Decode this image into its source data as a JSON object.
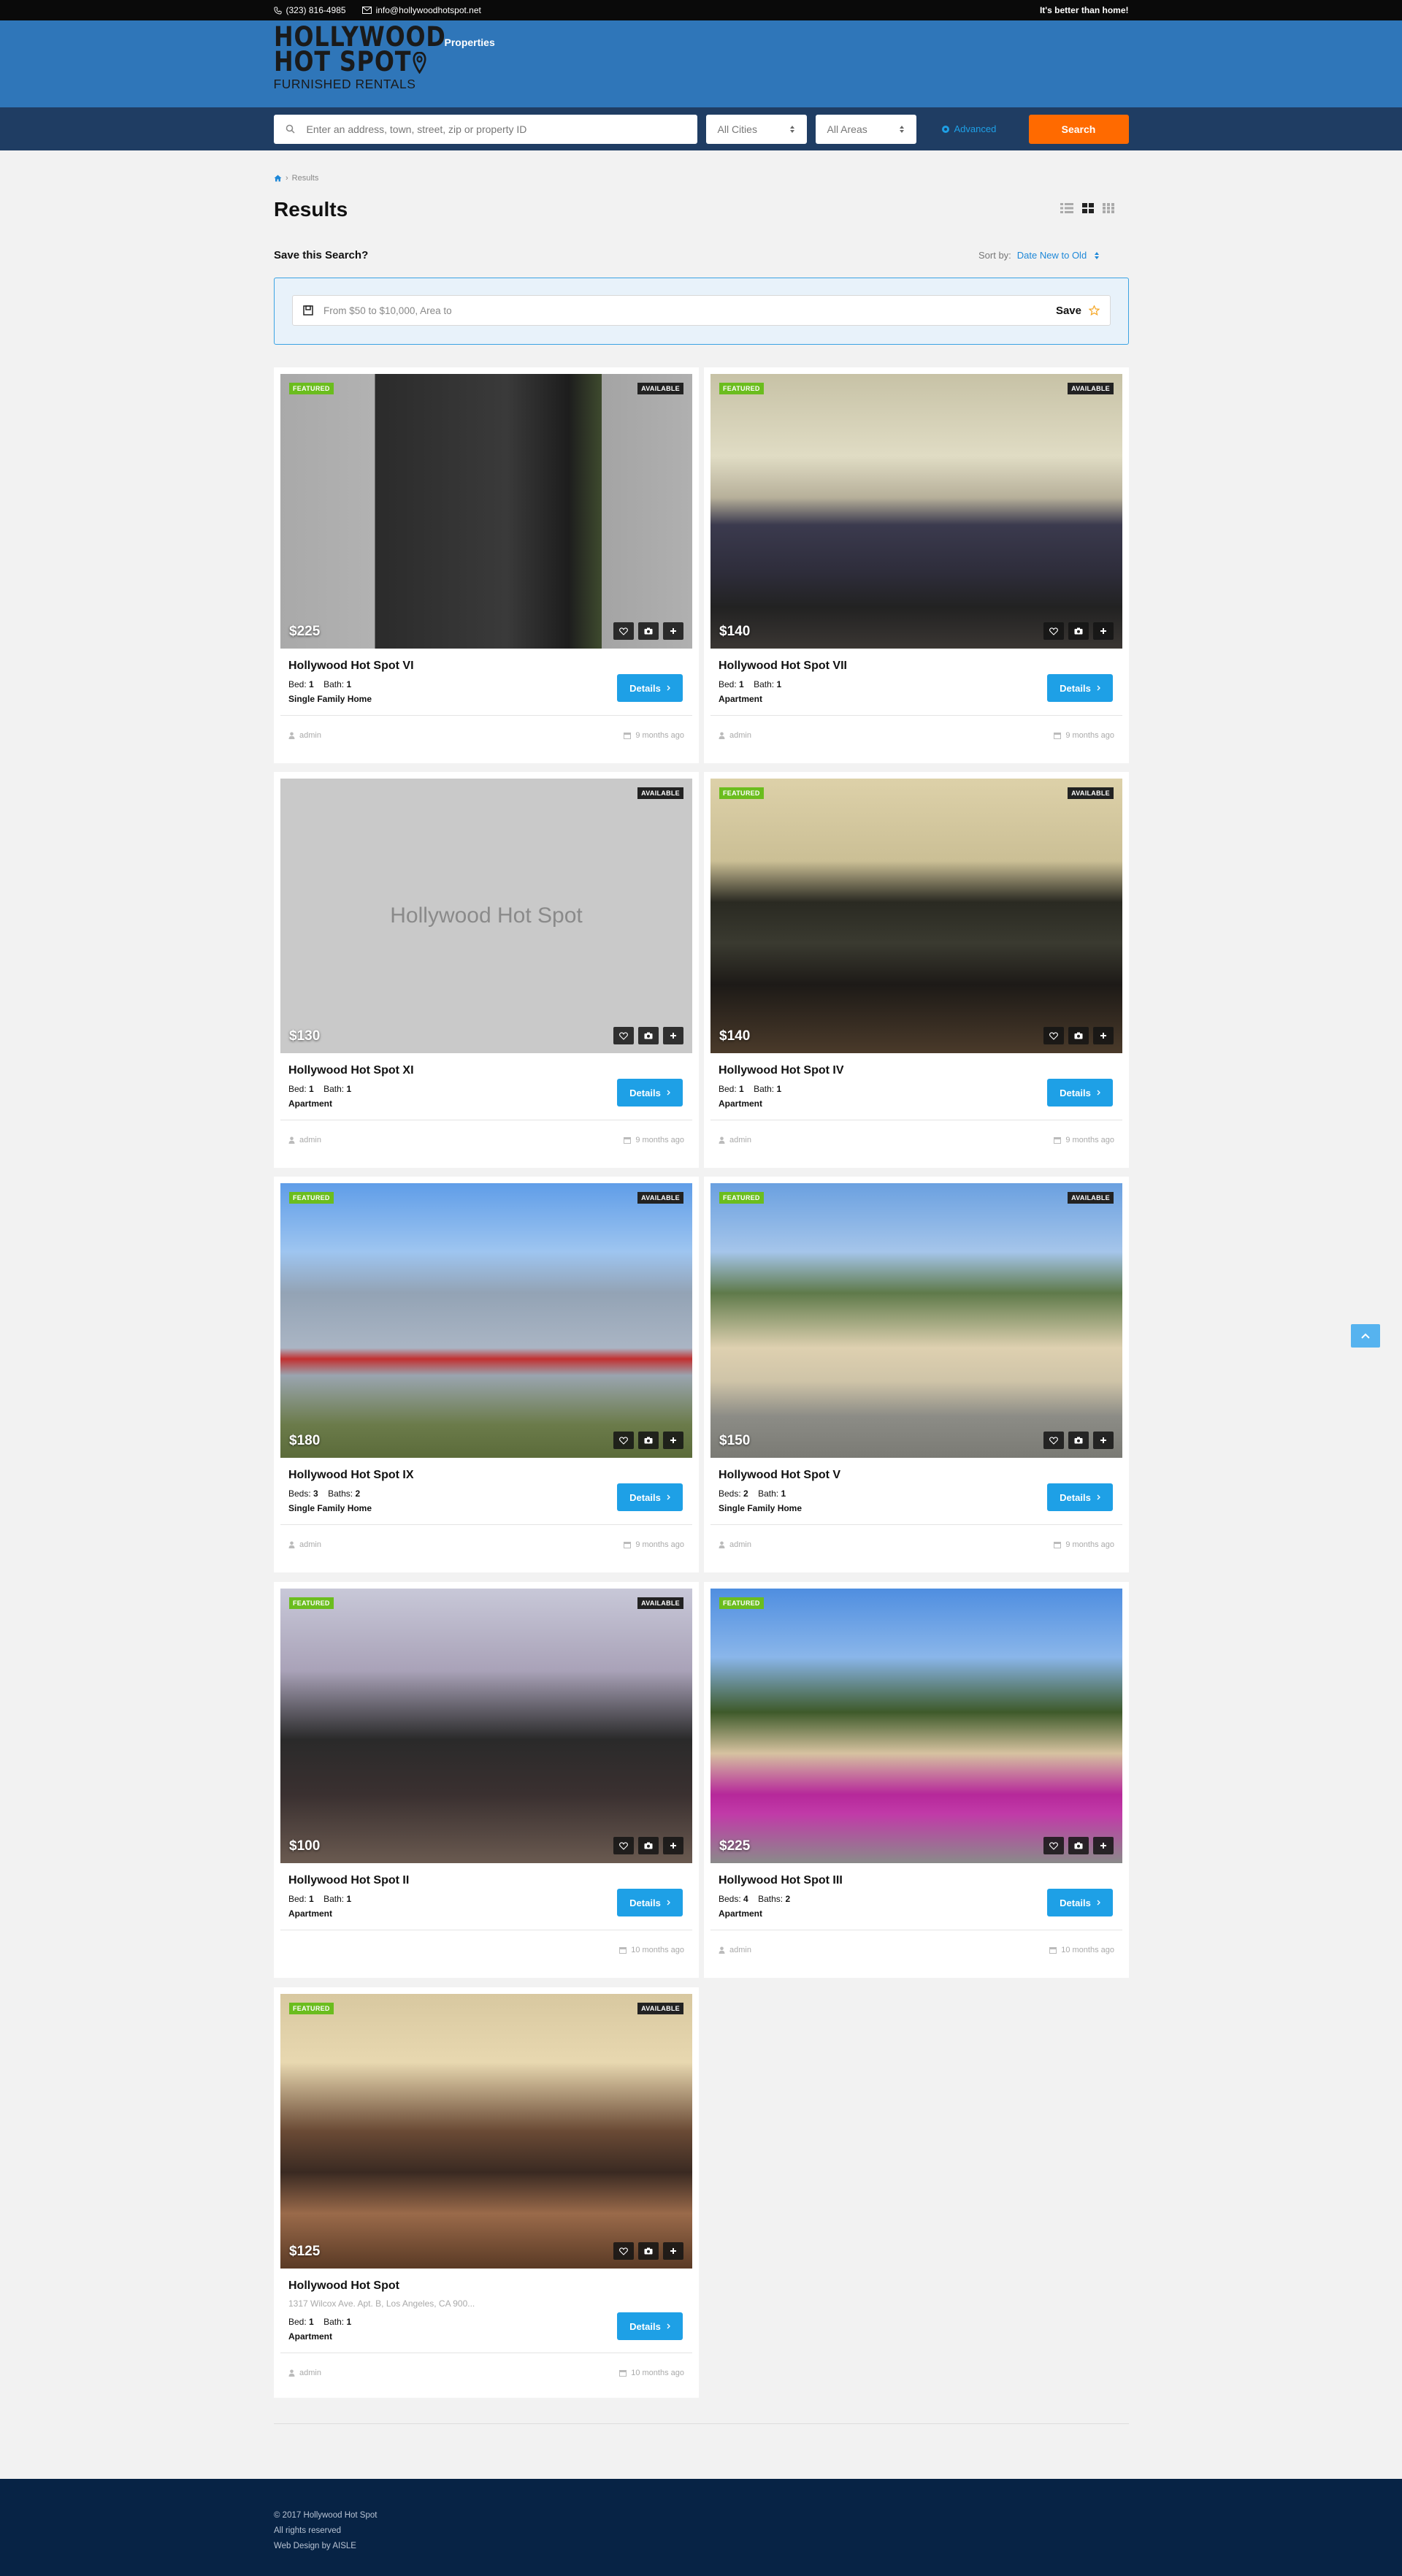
{
  "topbar": {
    "phone": "(323) 816-4985",
    "email": "info@hollywoodhotspot.net",
    "tagline": "It's better than home!"
  },
  "header": {
    "logo_line1": "HOLLYWOOD",
    "logo_line2": "HOT SPOT",
    "logo_line3": "FURNISHED RENTALS",
    "nav_properties": "Properties"
  },
  "search": {
    "placeholder": "Enter an address, town, street, zip or property ID",
    "cities": "All Cities",
    "areas": "All Areas",
    "advanced": "Advanced",
    "button": "Search"
  },
  "breadcrumb": {
    "current": "Results"
  },
  "page_title": "Results",
  "save_search": {
    "title": "Save this Search?",
    "criteria": "From $50 to $10,000, Area  to",
    "save_label": "Save"
  },
  "sort": {
    "label": "Sort by:",
    "value": "Date New to Old"
  },
  "labels": {
    "featured": "FEATURED",
    "available": "AVAILABLE",
    "details": "Details"
  },
  "listings": [
    {
      "title": "Hollywood Hot Spot VI",
      "price": "$225",
      "featured": true,
      "bed_label": "Bed:",
      "bed": "1",
      "bath_label": "Bath:",
      "bath": "1",
      "type": "Single Family Home",
      "author": "admin",
      "date": "9 months ago"
    },
    {
      "title": "Hollywood Hot Spot VII",
      "price": "$140",
      "featured": true,
      "bed_label": "Bed:",
      "bed": "1",
      "bath_label": "Bath:",
      "bath": "1",
      "type": "Apartment",
      "author": "admin",
      "date": "9 months ago"
    },
    {
      "title": "Hollywood Hot Spot XI",
      "price": "$130",
      "featured": false,
      "placeholder": "Hollywood Hot Spot",
      "bed_label": "Bed:",
      "bed": "1",
      "bath_label": "Bath:",
      "bath": "1",
      "type": "Apartment",
      "author": "admin",
      "date": "9 months ago"
    },
    {
      "title": "Hollywood Hot Spot IV",
      "price": "$140",
      "featured": true,
      "bed_label": "Bed:",
      "bed": "1",
      "bath_label": "Bath:",
      "bath": "1",
      "type": "Apartment",
      "author": "admin",
      "date": "9 months ago"
    },
    {
      "title": "Hollywood Hot Spot IX",
      "price": "$180",
      "featured": true,
      "bed_label": "Beds:",
      "bed": "3",
      "bath_label": "Baths:",
      "bath": "2",
      "type": "Single Family Home",
      "author": "admin",
      "date": "9 months ago"
    },
    {
      "title": "Hollywood Hot Spot V",
      "price": "$150",
      "featured": true,
      "bed_label": "Beds:",
      "bed": "2",
      "bath_label": "Bath:",
      "bath": "1",
      "type": "Single Family Home",
      "author": "admin",
      "date": "9 months ago"
    },
    {
      "title": "Hollywood Hot Spot II",
      "price": "$100",
      "featured": true,
      "bed_label": "Bed:",
      "bed": "1",
      "bath_label": "Bath:",
      "bath": "1",
      "type": "Apartment",
      "author": "",
      "date": "10 months ago"
    },
    {
      "title": "Hollywood Hot Spot III",
      "price": "$225",
      "featured": true,
      "available": false,
      "bed_label": "Beds:",
      "bed": "4",
      "bath_label": "Baths:",
      "bath": "2",
      "type": "Apartment",
      "author": "admin",
      "date": "10 months ago"
    },
    {
      "title": "Hollywood Hot Spot",
      "price": "$125",
      "featured": true,
      "address": "1317 Wilcox Ave. Apt. B, Los Angeles, CA 900...",
      "bed_label": "Bed:",
      "bed": "1",
      "bath_label": "Bath:",
      "bath": "1",
      "type": "Apartment",
      "author": "admin",
      "date": "10 months ago"
    }
  ],
  "footer": {
    "copyright": "© 2017 Hollywood Hot Spot",
    "rights": "All rights reserved",
    "credit": "Web Design by AISLE"
  },
  "colors": {
    "header_blue": "#2f76b9",
    "search_bar": "#1f3d63",
    "accent_orange": "#ff6a00",
    "accent_blue": "#1ea0e6",
    "featured_green": "#6bbd1e",
    "footer_navy": "#072345"
  }
}
